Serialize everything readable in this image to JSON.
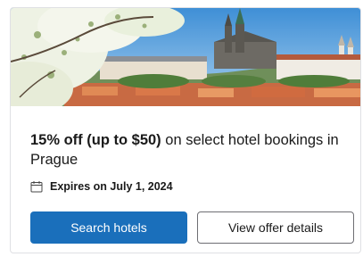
{
  "offer": {
    "headline_strong": "15% off (up to $50)",
    "headline_rest": " on select hotel bookings in Prague",
    "expires_text": "Expires on July 1, 2024"
  },
  "buttons": {
    "primary_label": "Search hotels",
    "secondary_label": "View offer details"
  },
  "colors": {
    "primary_button": "#1a6fbb",
    "card_border": "#dfe0e4"
  },
  "icons": {
    "expires": "calendar-icon"
  }
}
